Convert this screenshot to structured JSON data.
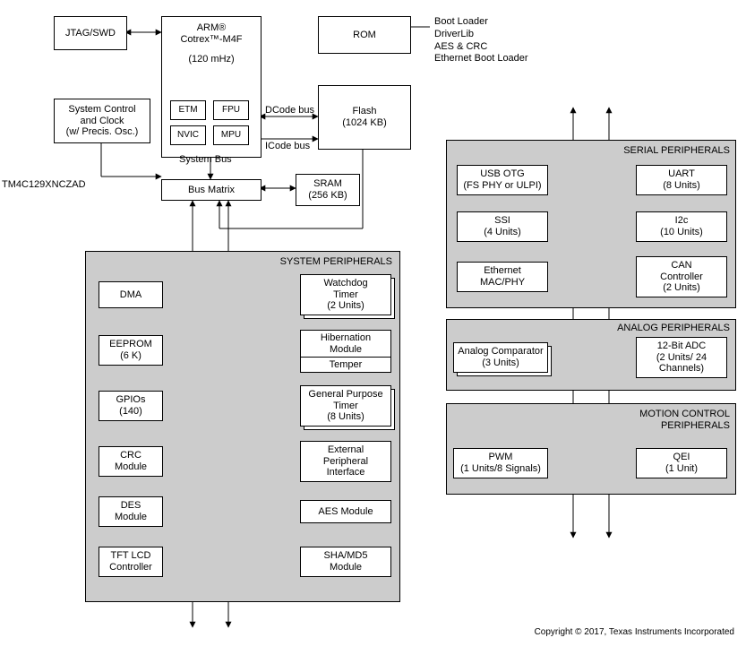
{
  "part_number": "TM4C129XNCZAD",
  "copyright": "Copyright © 2017, Texas Instruments Incorporated",
  "top": {
    "jtag": "JTAG/SWD",
    "arm_title": "ARM®",
    "arm_sub": "Cotrex™-M4F",
    "arm_freq": "(120 mHz)",
    "etm": "ETM",
    "fpu": "FPU",
    "nvic": "NVIC",
    "mpu": "MPU",
    "rom": "ROM",
    "flash_l1": "Flash",
    "flash_l2": "(1024 KB)",
    "rom_notes": {
      "l1": "Boot Loader",
      "l2": "DriverLib",
      "l3": "AES & CRC",
      "l4": "Ethernet Boot Loader"
    },
    "syscc_l1": "System Control",
    "syscc_l2": "and Clock",
    "syscc_l3": "(w/ Precis. Osc.)",
    "dcode": "DCode bus",
    "icode": "ICode bus",
    "sysbus": "System Bus",
    "busmatrix": "Bus Matrix",
    "sram_l1": "SRAM",
    "sram_l2": "(256 KB)"
  },
  "sys": {
    "title": "SYSTEM PERIPHERALS",
    "left": {
      "dma": "DMA",
      "eeprom_l1": "EEPROM",
      "eeprom_l2": "(6 K)",
      "gpio_l1": "GPIOs",
      "gpio_l2": "(140)",
      "crc_l1": "CRC",
      "crc_l2": "Module",
      "des_l1": "DES",
      "des_l2": "Module",
      "tft_l1": "TFT LCD",
      "tft_l2": "Controller"
    },
    "right": {
      "wd_l1": "Watchdog",
      "wd_l2": "Timer",
      "wd_l3": "(2 Units)",
      "hib_l1": "Hibernation",
      "hib_l2": "Module",
      "hib_l3": "Temper",
      "gpt_l1": "General Purpose",
      "gpt_l2": "Timer",
      "gpt_l3": "(8 Units)",
      "epi_l1": "External",
      "epi_l2": "Peripheral",
      "epi_l3": "Interface",
      "aes": "AES Module",
      "sha_l1": "SHA/MD5",
      "sha_l2": "Module"
    }
  },
  "serial": {
    "title": "SERIAL PERIPHERALS",
    "usb_l1": "USB OTG",
    "usb_l2": "(FS PHY or ULPI)",
    "uart_l1": "UART",
    "uart_l2": "(8 Units)",
    "ssi_l1": "SSI",
    "ssi_l2": "(4 Units)",
    "i2c_l1": "I2c",
    "i2c_l2": "(10 Units)",
    "eth_l1": "Ethernet",
    "eth_l2": "MAC/PHY",
    "can_l1": "CAN",
    "can_l2": "Controller",
    "can_l3": "(2 Units)"
  },
  "analog": {
    "title": "ANALOG PERIPHERALS",
    "ac_l1": "Analog Comparator",
    "ac_l2": "(3 Units)",
    "adc_l1": "12-Bit ADC",
    "adc_l2": "(2 Units/ 24",
    "adc_l3": "Channels)"
  },
  "motion": {
    "title_l1": "MOTION CONTROL",
    "title_l2": "PERIPHERALS",
    "pwm_l1": "PWM",
    "pwm_l2": "(1 Units/8 Signals)",
    "qei_l1": "QEI",
    "qei_l2": "(1 Unit)"
  }
}
